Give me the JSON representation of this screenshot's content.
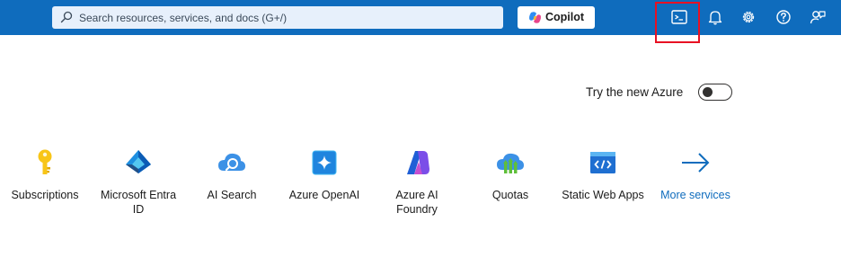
{
  "search": {
    "placeholder": "Search resources, services, and docs (G+/)",
    "icon": "search-icon"
  },
  "copilot": {
    "label": "Copilot",
    "icon": "copilot-icon"
  },
  "toolbar_icons": [
    "cloud-shell-icon",
    "notifications-bell-icon",
    "settings-gear-icon",
    "help-question-icon",
    "feedback-person-icon"
  ],
  "highlight_color": "#e81123",
  "brand_color": "#0f6cbd",
  "toggle": {
    "label": "Try the new Azure",
    "state": "off"
  },
  "services": [
    {
      "label": "Subscriptions",
      "icon": "key-icon"
    },
    {
      "label": "Microsoft Entra ID",
      "icon": "entra-id-icon"
    },
    {
      "label": "AI Search",
      "icon": "ai-search-icon"
    },
    {
      "label": "Azure OpenAI",
      "icon": "openai-icon"
    },
    {
      "label": "Azure AI Foundry",
      "icon": "ai-foundry-icon"
    },
    {
      "label": "Quotas",
      "icon": "quotas-icon"
    },
    {
      "label": "Static Web Apps",
      "icon": "static-web-apps-icon"
    },
    {
      "label": "More services",
      "icon": "arrow-right-icon"
    }
  ]
}
